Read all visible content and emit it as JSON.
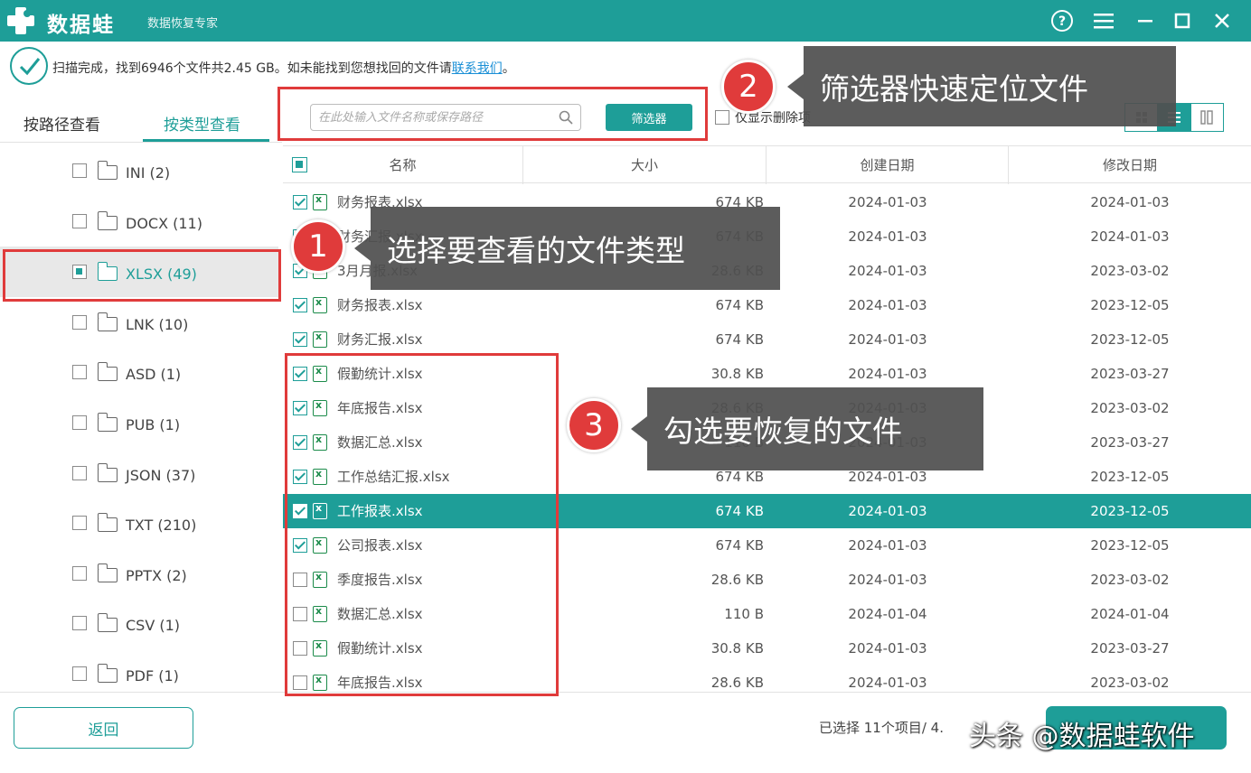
{
  "app": {
    "name": "数据蛙",
    "subtitle": "数据恢复专家"
  },
  "titlebar_icons": [
    "help-icon",
    "menu-icon",
    "minimize-icon",
    "maximize-icon",
    "close-icon"
  ],
  "status": {
    "text_before": "扫描完成，找到6946个文件共2.45 GB。如未能找到您想找回的文件请",
    "link": "联系我们",
    "text_after": "。"
  },
  "tabs": {
    "by_path": "按路径查看",
    "by_type": "按类型查看",
    "active": "by_type"
  },
  "file_types": [
    {
      "label": "INI (2)",
      "state": "unchecked",
      "selected": false
    },
    {
      "label": "DOCX (11)",
      "state": "unchecked",
      "selected": false
    },
    {
      "label": "XLSX (49)",
      "state": "partial",
      "selected": true
    },
    {
      "label": "LNK (10)",
      "state": "unchecked",
      "selected": false
    },
    {
      "label": "ASD (1)",
      "state": "unchecked",
      "selected": false
    },
    {
      "label": "PUB (1)",
      "state": "unchecked",
      "selected": false
    },
    {
      "label": "JSON (37)",
      "state": "unchecked",
      "selected": false
    },
    {
      "label": "TXT (210)",
      "state": "unchecked",
      "selected": false
    },
    {
      "label": "PPTX (2)",
      "state": "unchecked",
      "selected": false
    },
    {
      "label": "CSV (1)",
      "state": "unchecked",
      "selected": false
    },
    {
      "label": "PDF (1)",
      "state": "unchecked",
      "selected": false
    }
  ],
  "search": {
    "placeholder": "在此处输入文件名称或保存路径",
    "value": ""
  },
  "filter_button": "筛选器",
  "only_deleted": {
    "label": "仅显示删除项",
    "checked": false
  },
  "view_modes": [
    {
      "name": "grid",
      "active": false
    },
    {
      "name": "list",
      "active": true
    },
    {
      "name": "detail",
      "active": false
    }
  ],
  "table": {
    "headers": {
      "name": "名称",
      "size": "大小",
      "created": "创建日期",
      "modified": "修改日期"
    },
    "rows": [
      {
        "name": "财务报表.xlsx",
        "size": "674 KB",
        "created": "2024-01-03",
        "modified": "2024-01-03",
        "checked": true,
        "highlight": false
      },
      {
        "name": "财务汇报.xlsx",
        "size": "674 KB",
        "created": "2024-01-03",
        "modified": "2024-01-03",
        "checked": true,
        "highlight": false
      },
      {
        "name": "3月月报.xlsx",
        "size": "28.6 KB",
        "created": "2024-01-03",
        "modified": "2023-03-02",
        "checked": true,
        "highlight": false
      },
      {
        "name": "财务报表.xlsx",
        "size": "674 KB",
        "created": "2024-01-03",
        "modified": "2023-12-05",
        "checked": true,
        "highlight": false
      },
      {
        "name": "财务汇报.xlsx",
        "size": "674 KB",
        "created": "2024-01-03",
        "modified": "2023-12-05",
        "checked": true,
        "highlight": false
      },
      {
        "name": "假勤统计.xlsx",
        "size": "30.8 KB",
        "created": "2024-01-03",
        "modified": "2023-03-27",
        "checked": true,
        "highlight": false
      },
      {
        "name": "年底报告.xlsx",
        "size": "28.6 KB",
        "created": "2024-01-03",
        "modified": "2023-03-02",
        "checked": true,
        "highlight": false
      },
      {
        "name": "数据汇总.xlsx",
        "size": "110 B",
        "created": "2024-01-03",
        "modified": "2023-03-27",
        "checked": true,
        "highlight": false
      },
      {
        "name": "工作总结汇报.xlsx",
        "size": "674 KB",
        "created": "2024-01-03",
        "modified": "2023-12-05",
        "checked": true,
        "highlight": false
      },
      {
        "name": "工作报表.xlsx",
        "size": "674 KB",
        "created": "2024-01-03",
        "modified": "2023-12-05",
        "checked": true,
        "highlight": true
      },
      {
        "name": "公司报表.xlsx",
        "size": "674 KB",
        "created": "2024-01-03",
        "modified": "2023-12-05",
        "checked": true,
        "highlight": false
      },
      {
        "name": "季度报告.xlsx",
        "size": "28.6 KB",
        "created": "2024-01-03",
        "modified": "2023-03-02",
        "checked": false,
        "highlight": false
      },
      {
        "name": "数据汇总.xlsx",
        "size": "110 B",
        "created": "2024-01-04",
        "modified": "2024-01-04",
        "checked": false,
        "highlight": false
      },
      {
        "name": "假勤统计.xlsx",
        "size": "30.8 KB",
        "created": "2024-01-03",
        "modified": "2023-03-27",
        "checked": false,
        "highlight": false
      },
      {
        "name": "年底报告.xlsx",
        "size": "28.6 KB",
        "created": "2024-01-03",
        "modified": "2023-03-02",
        "checked": false,
        "highlight": false
      }
    ]
  },
  "footer": {
    "back_button": "返回",
    "selected_info": "已选择 11个项目/ 4."
  },
  "annotations": [
    {
      "number": "1",
      "text": "选择要查看的文件类型"
    },
    {
      "number": "2",
      "text": "筛选器快速定位文件"
    },
    {
      "number": "3",
      "text": "勾选要恢复的文件"
    }
  ],
  "watermark": "头条 @数据蛙软件",
  "colors": {
    "brand": "#1e9e98",
    "annotation_red": "#e03b3b",
    "callout_bg": "#505050",
    "link": "#1a8fd6"
  }
}
